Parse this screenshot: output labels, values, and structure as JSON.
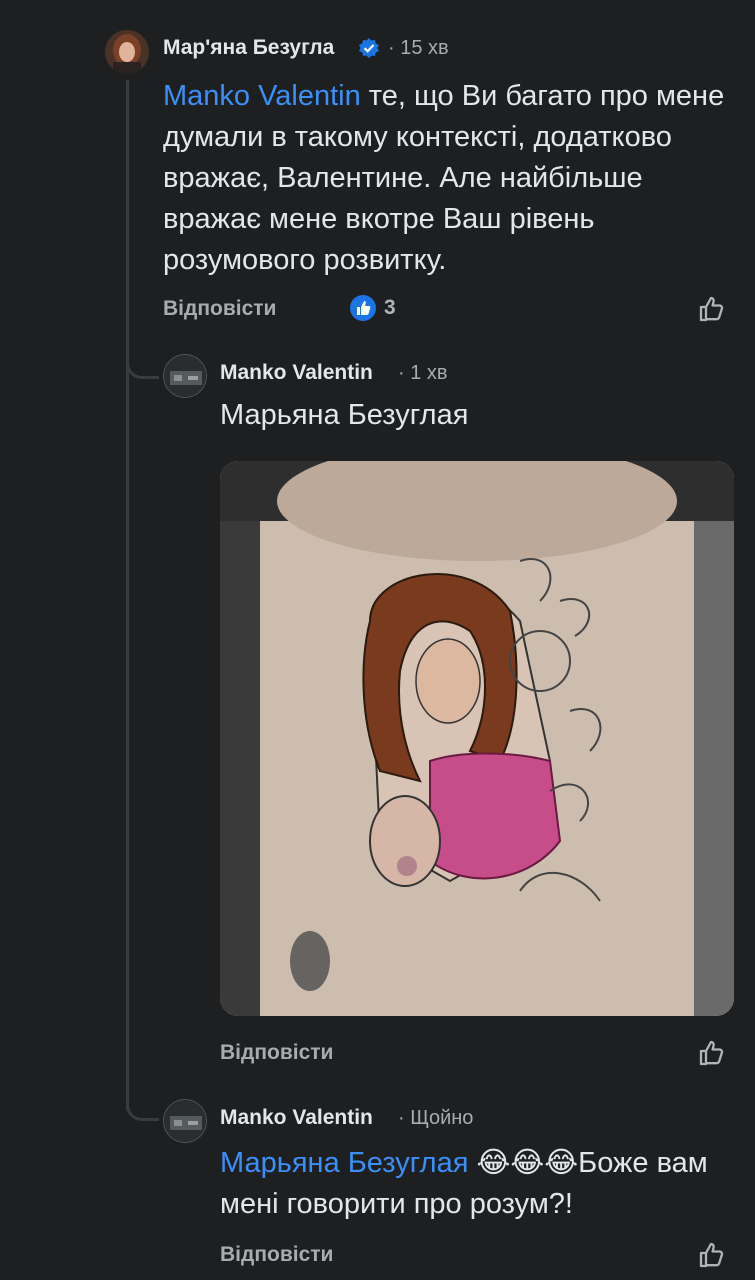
{
  "comment1": {
    "author": "Мар'яна Безугла",
    "time": "· 15 хв",
    "mention": "Manko Valentin",
    "text": " те, що Ви багато про мене думали в такому контексті, додатково вражає, Валентине. Але найбільше вражає мене вкотре Ваш рівень розумового розвитку.",
    "reply": "Відповісти",
    "reactions": "3"
  },
  "comment2": {
    "author": "Manko Valentin",
    "time": "· 1 хв",
    "mention": "Марьяна Безуглая",
    "reply": "Відповісти"
  },
  "comment3": {
    "author": "Manko Valentin",
    "time": "· Щойно",
    "mention": "Марьяна Безуглая",
    "emoji": "😂😂😂",
    "text": "Боже вам мені говорити про розум?!",
    "reply": "Відповісти"
  },
  "colors": {
    "accent": "#3b8ff7",
    "background": "#1e1f21",
    "verified": "#1b74e4"
  }
}
